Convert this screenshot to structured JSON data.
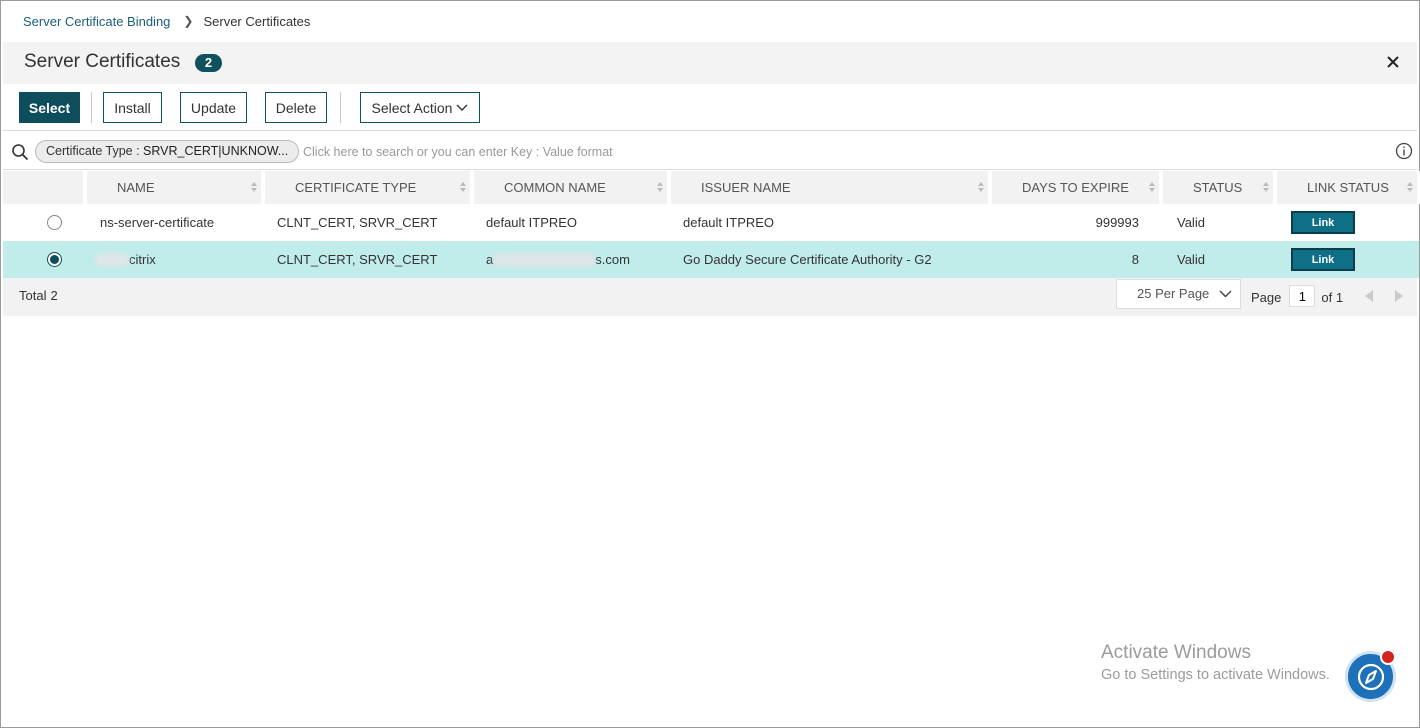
{
  "breadcrumb": {
    "parent": "Server Certificate Binding",
    "current": "Server Certificates"
  },
  "header": {
    "title": "Server Certificates",
    "count": "2"
  },
  "toolbar": {
    "select": "Select",
    "install": "Install",
    "update": "Update",
    "delete": "Delete",
    "select_action": "Select Action"
  },
  "search": {
    "chip_key": "Certificate Type : ",
    "chip_value": "SRVR_CERT|UNKNOW...",
    "placeholder": "Click here to search or you can enter Key : Value format"
  },
  "table": {
    "columns": [
      "NAME",
      "CERTIFICATE TYPE",
      "COMMON NAME",
      "ISSUER NAME",
      "DAYS TO EXPIRE",
      "STATUS",
      "LINK STATUS"
    ],
    "rows": [
      {
        "selected": false,
        "name": "ns-server-certificate",
        "certificate_type": "CLNT_CERT, SRVR_CERT",
        "common_name": "default ITPREO",
        "issuer_name": "default ITPREO",
        "days_to_expire": "999993",
        "status": "Valid",
        "link": "Link"
      },
      {
        "selected": true,
        "name": "citrix",
        "certificate_type": "CLNT_CERT, SRVR_CERT",
        "common_name_prefix": "a",
        "common_name": "s.com",
        "issuer_name": "Go Daddy Secure Certificate Authority - G2",
        "days_to_expire": "8",
        "status": "Valid",
        "link": "Link"
      }
    ]
  },
  "footer": {
    "total_label": "Total",
    "total_value": "2",
    "per_page": "25 Per Page",
    "page_label": "Page",
    "page_value": "1",
    "of_label": "of 1"
  },
  "watermark": {
    "line1": "Activate Windows",
    "line2": "Go to Settings to activate Windows."
  },
  "colors": {
    "primary": "#0e4e5c",
    "selected_row": "#c0ecea",
    "link_button": "#0f6f86",
    "fab": "#1e70b8",
    "badge": "#d0261e"
  }
}
